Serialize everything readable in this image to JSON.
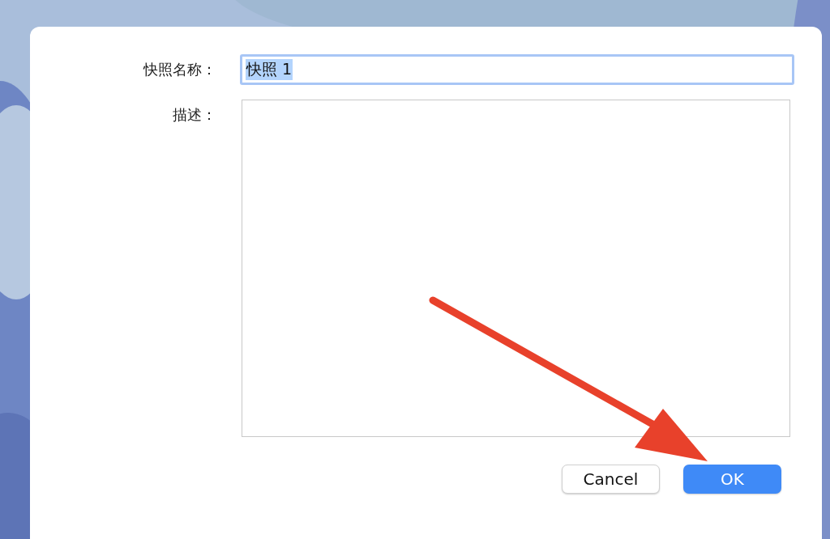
{
  "dialog": {
    "fields": [
      {
        "label": "快照名称：",
        "kind": "text",
        "value": "快照 1",
        "selected": true
      },
      {
        "label": "描述：",
        "kind": "textarea"
      }
    ],
    "buttons": [
      {
        "label": "Cancel",
        "default": false
      },
      {
        "label": "OK",
        "default": true
      }
    ]
  }
}
